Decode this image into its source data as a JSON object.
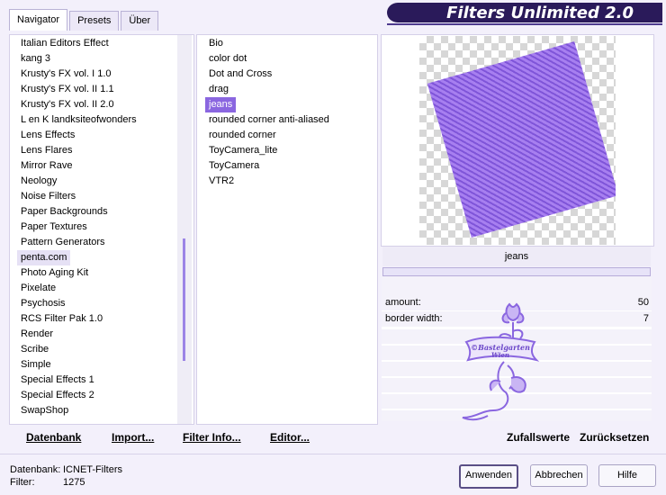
{
  "app_title": "Filters Unlimited 2.0",
  "tabs": [
    "Navigator",
    "Presets",
    "Über"
  ],
  "categories": [
    "Italian Editors Effect",
    "kang 3",
    "Krusty's FX vol. I 1.0",
    "Krusty's FX vol. II 1.1",
    "Krusty's FX vol. II 2.0",
    "L en K landksiteofwonders",
    "Lens Effects",
    "Lens Flares",
    "Mirror Rave",
    "Neology",
    "Noise Filters",
    "Paper Backgrounds",
    "Paper Textures",
    "Pattern Generators",
    "penta.com",
    "Photo Aging Kit",
    "Pixelate",
    "Psychosis",
    "RCS Filter Pak 1.0",
    "Render",
    "Scribe",
    "Simple",
    "Special Effects 1",
    "Special Effects 2",
    "SwapShop"
  ],
  "selected_category": "penta.com",
  "filters": [
    "Bio",
    "color dot",
    "Dot and Cross",
    "drag",
    "jeans",
    "rounded corner anti-aliased",
    "rounded corner",
    "ToyCamera_lite",
    "ToyCamera",
    "VTR2"
  ],
  "selected_filter": "jeans",
  "current_filter_label": "jeans",
  "params": [
    {
      "label": "amount:",
      "value": "50"
    },
    {
      "label": "border width:",
      "value": "7"
    }
  ],
  "actions": {
    "database": "Datenbank",
    "import": "Import...",
    "filter_info": "Filter Info...",
    "editor": "Editor...",
    "random": "Zufallswerte",
    "reset": "Zurücksetzen"
  },
  "status": {
    "db_label": "Datenbank:",
    "db_value": "ICNET-Filters",
    "filter_label": "Filter:",
    "filter_value": "1275"
  },
  "buttons": {
    "apply": "Anwenden",
    "cancel": "Abbrechen",
    "help": "Hilfe"
  },
  "watermark": {
    "line1": "©Bastelgarten",
    "line2": "Wien"
  },
  "colors": {
    "accent": "#8a66e0",
    "title_bg": "#2a1a5a",
    "pattern": "#a77ff0"
  }
}
